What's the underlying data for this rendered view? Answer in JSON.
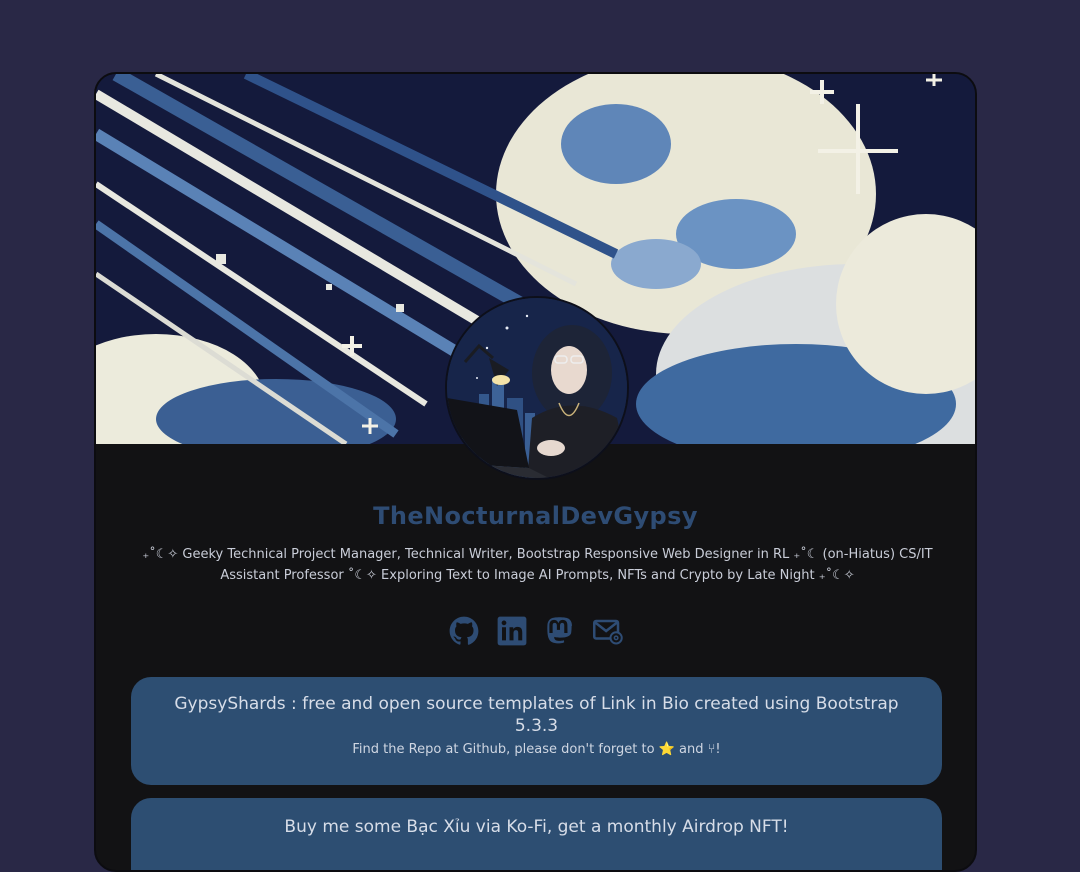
{
  "profile": {
    "name": "TheNocturnalDevGypsy",
    "bio": "₊˚☾✧ Geeky Technical Project Manager, Technical Writer, Bootstrap Responsive Web Designer in RL ₊˚☾ (on-Hiatus) CS/IT Assistant Professor ˚☾✧ Exploring Text to Image AI Prompts, NFTs and Crypto by Late Night ₊˚☾✧"
  },
  "socials": [
    {
      "icon": "github-icon"
    },
    {
      "icon": "linkedin-icon"
    },
    {
      "icon": "mastodon-icon"
    },
    {
      "icon": "email-icon"
    }
  ],
  "links": [
    {
      "title": "GypsyShards : free and open source templates of Link in Bio created using Bootstrap 5.3.3",
      "subtitle": "Find the Repo at Github, please don't forget to ⭐ and ⑂!"
    },
    {
      "title": "Buy me some Bạc Xỉu via Ko-Fi, get a monthly Airdrop NFT!",
      "subtitle": ""
    }
  ],
  "colors": {
    "page_bg": "#292846",
    "card_bg": "#121214",
    "accent": "#2d4e72",
    "title": "#2e4c74",
    "icon": "#2e4c74"
  }
}
